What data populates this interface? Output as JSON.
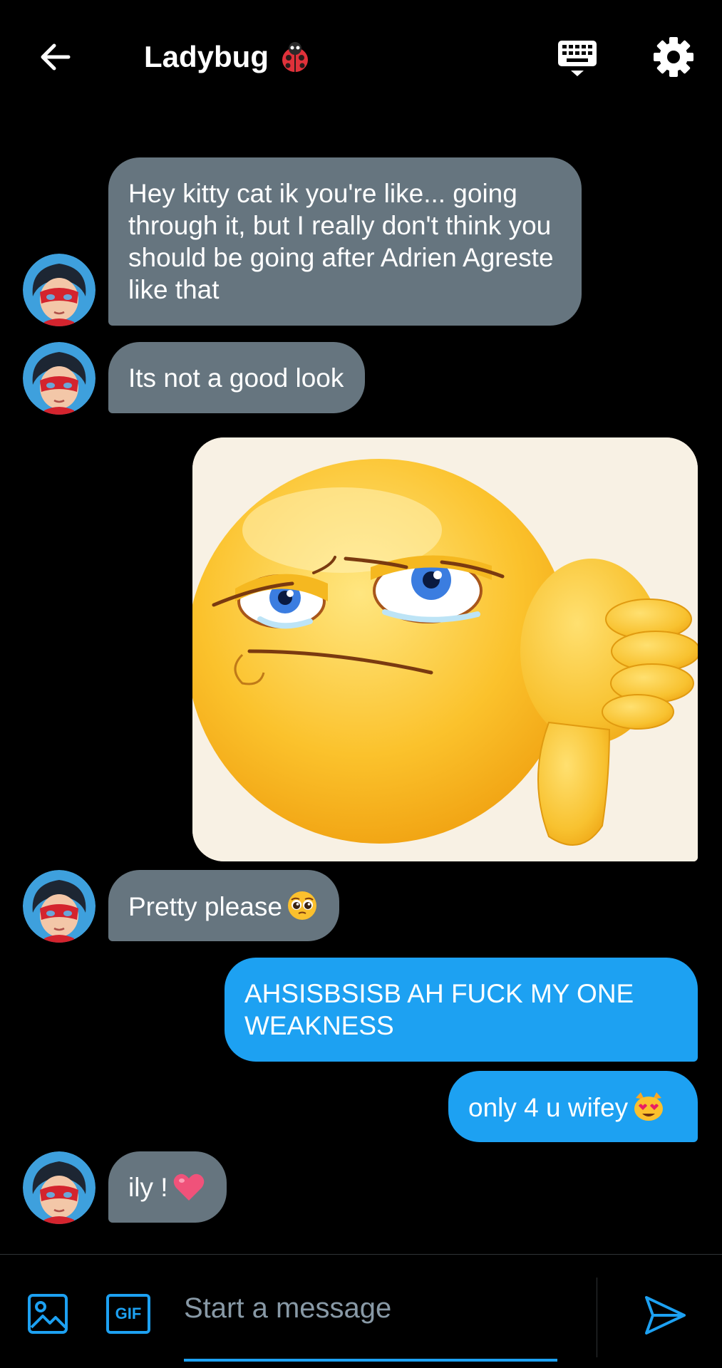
{
  "header": {
    "title": "Ladybug",
    "title_emoji": "ladybug-emoji",
    "back_icon": "arrow-left-icon",
    "keyboard_icon": "keyboard-icon",
    "settings_icon": "gear-icon"
  },
  "messages": [
    {
      "sender": "them",
      "text": "Hey kitty cat ik you're like... going through it, but I really don't think you should be going after Adrien Agreste like that"
    },
    {
      "sender": "them",
      "text": "Its not a good look"
    },
    {
      "sender": "them",
      "type": "image",
      "image": "disappointed-thumbs-down-emoji"
    },
    {
      "sender": "them",
      "text": "Pretty please",
      "emoji": "pleading-face-emoji"
    },
    {
      "sender": "me",
      "text": "AHSISBSISB AH FUCK MY ONE WEAKNESS"
    },
    {
      "sender": "me",
      "text": "only 4 u wifey",
      "emoji": "heart-eyes-cat-emoji"
    },
    {
      "sender": "them",
      "text": "ily !",
      "emoji": "pink-heart-emoji"
    }
  ],
  "composer": {
    "placeholder": "Start a message",
    "gif_label": "GIF",
    "media_icon": "image-icon",
    "send_icon": "send-icon"
  },
  "colors": {
    "background": "#000000",
    "received_bubble": "#66757f",
    "sent_bubble": "#1da1f2",
    "accent": "#1da1f2"
  }
}
